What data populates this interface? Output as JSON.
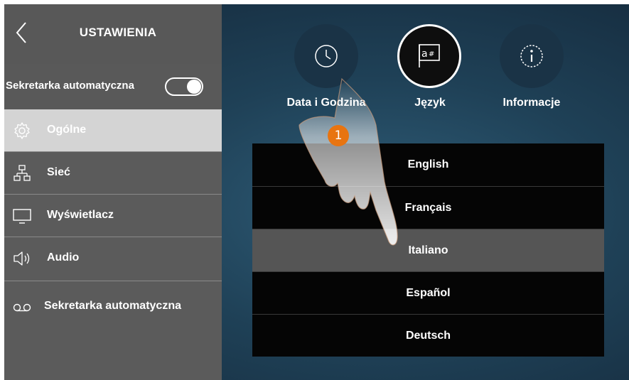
{
  "sidebar": {
    "title": "USTAWIENIA",
    "toggle": {
      "label": "Sekretarka automatyczna",
      "state": "on"
    },
    "items": [
      {
        "label": "Ogólne",
        "icon": "gear-icon",
        "active": true
      },
      {
        "label": "Sieć",
        "icon": "network-icon",
        "active": false
      },
      {
        "label": "Wyświetlacz",
        "icon": "display-icon",
        "active": false
      },
      {
        "label": "Audio",
        "icon": "speaker-icon",
        "active": false
      },
      {
        "label": "Sekretarka automatyczna",
        "icon": "voicemail-icon",
        "active": false
      }
    ]
  },
  "tabs": [
    {
      "label": "Data i Godzina",
      "icon": "clock-icon"
    },
    {
      "label": "Język",
      "icon": "language-icon",
      "selected": true
    },
    {
      "label": "Informacje",
      "icon": "info-icon"
    }
  ],
  "languages": {
    "items": [
      "English",
      "Français",
      "Italiano",
      "Español",
      "Deutsch"
    ],
    "selected": "Italiano"
  },
  "callout": {
    "number": "1",
    "color": "#e87410"
  },
  "colors": {
    "selected_row": "#555555",
    "active_sidebar": "#d4d4d4",
    "sidebar": "#5b5b5b"
  }
}
